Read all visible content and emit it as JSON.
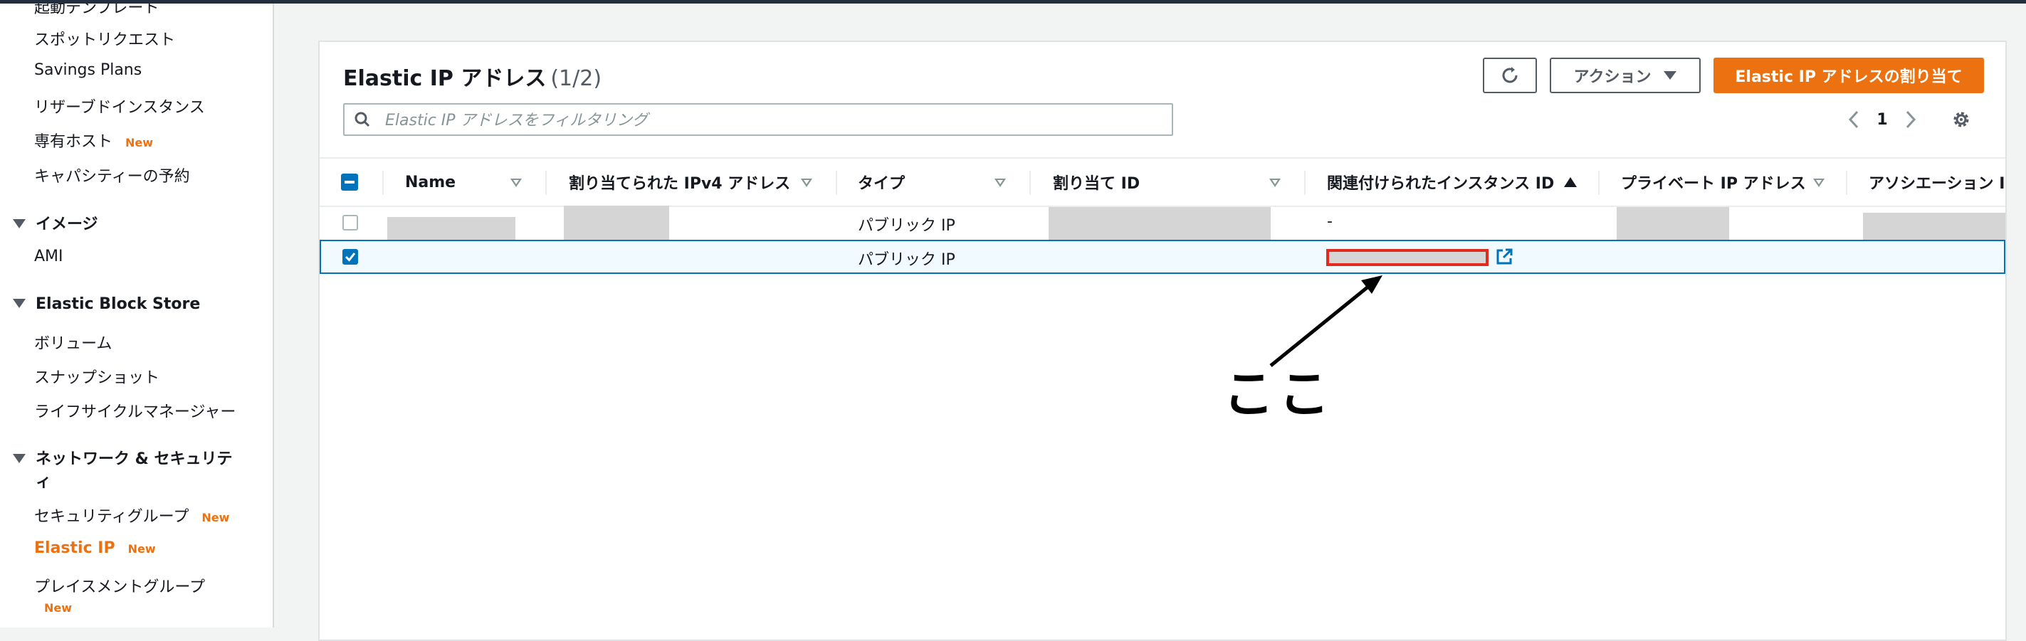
{
  "sidebar": {
    "items_top": [
      {
        "label": "起動テンプレート",
        "new": ""
      },
      {
        "label": "スポットリクエスト",
        "new": ""
      },
      {
        "label": "Savings Plans",
        "new": ""
      },
      {
        "label": "リザーブドインスタンス",
        "new": ""
      },
      {
        "label": "専有ホスト",
        "new": "New"
      },
      {
        "label": "キャパシティーの予約",
        "new": ""
      }
    ],
    "section_images": "イメージ",
    "ami": "AMI",
    "section_ebs": "Elastic Block Store",
    "volumes": "ボリューム",
    "snapshots": "スナップショット",
    "lifecycle": "ライフサイクルマネージャー",
    "section_network_line1": "ネットワーク & セキュリテ",
    "section_network_line2": "ィ",
    "security_groups": {
      "label": "セキュリティグループ",
      "new": "New"
    },
    "elastic_ip": {
      "label": "Elastic IP",
      "new": "New"
    },
    "placement_groups": {
      "label": "プレイスメントグループ",
      "new": "New"
    }
  },
  "panel": {
    "title": "Elastic IP アドレス",
    "count": "(1/2)",
    "actions_label": "アクション",
    "allocate_label": "Elastic IP アドレスの割り当て",
    "search_placeholder": "Elastic IP アドレスをフィルタリング",
    "page_number": "1"
  },
  "table": {
    "columns": [
      "Name",
      "割り当てられた IPv4 アドレス",
      "タイプ",
      "割り当て ID",
      "関連付けられたインスタンス ID",
      "プライベート IP アドレス",
      "アソシエーション I"
    ],
    "rows": [
      {
        "selected": false,
        "type": "パブリック IP",
        "instance_id": "-"
      },
      {
        "selected": true,
        "type": "パブリック IP",
        "instance_id": ""
      }
    ]
  },
  "annotation": {
    "label": "ここ"
  },
  "colors": {
    "accent": "#ec7211",
    "selection": "#0073bb",
    "highlight_border": "#e02b1e"
  }
}
